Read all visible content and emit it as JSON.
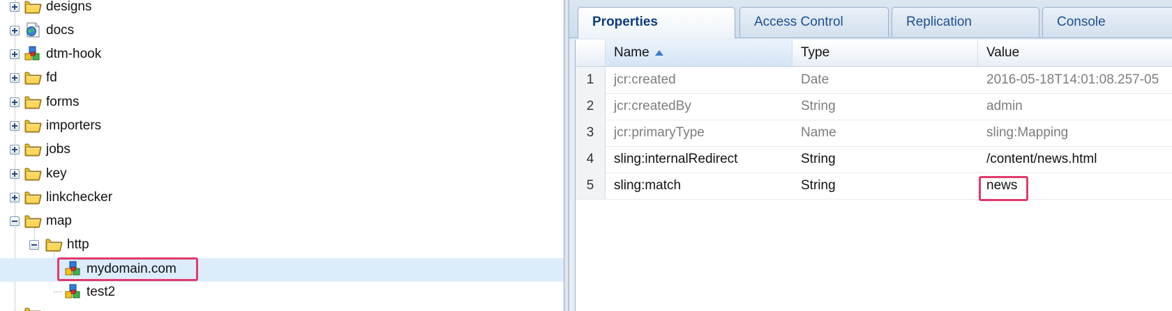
{
  "tree": {
    "nodes": [
      {
        "label": "designs",
        "icon": "folder-icon",
        "toggle": "expand"
      },
      {
        "label": "docs",
        "icon": "document-globe-icon",
        "toggle": "expand"
      },
      {
        "label": "dtm-hook",
        "icon": "node-cubes-icon",
        "toggle": "expand"
      },
      {
        "label": "fd",
        "icon": "folder-icon",
        "toggle": "expand"
      },
      {
        "label": "forms",
        "icon": "folder-icon",
        "toggle": "expand"
      },
      {
        "label": "importers",
        "icon": "folder-icon",
        "toggle": "expand"
      },
      {
        "label": "jobs",
        "icon": "folder-icon",
        "toggle": "expand"
      },
      {
        "label": "key",
        "icon": "folder-icon",
        "toggle": "expand"
      },
      {
        "label": "linkchecker",
        "icon": "folder-icon",
        "toggle": "expand"
      },
      {
        "label": "map",
        "icon": "folder-icon",
        "toggle": "collapse"
      },
      {
        "label": "http",
        "icon": "folder-icon",
        "toggle": "collapse"
      },
      {
        "label": "mydomain.com",
        "icon": "node-cubes-icon",
        "selected": true
      },
      {
        "label": "test2",
        "icon": "node-cubes-icon"
      }
    ]
  },
  "tabs": [
    "Properties",
    "Access Control",
    "Replication",
    "Console"
  ],
  "active_tab": "Properties",
  "grid": {
    "columns": [
      "Name",
      "Type",
      "Value"
    ],
    "sorted_column": "Name",
    "rows": [
      {
        "num": "1",
        "name": "jcr:created",
        "type": "Date",
        "value": "2016-05-18T14:01:08.257-05",
        "protected": true
      },
      {
        "num": "2",
        "name": "jcr:createdBy",
        "type": "String",
        "value": "admin",
        "protected": true
      },
      {
        "num": "3",
        "name": "jcr:primaryType",
        "type": "Name",
        "value": "sling:Mapping",
        "protected": true
      },
      {
        "num": "4",
        "name": "sling:internalRedirect",
        "type": "String",
        "value": "/content/news.html",
        "protected": false
      },
      {
        "num": "5",
        "name": "sling:match",
        "type": "String",
        "value": "news",
        "protected": false
      }
    ]
  },
  "colors": {
    "highlight": "#e03a6a",
    "selection": "#dcecfb",
    "tab_text": "#1d4f91"
  }
}
